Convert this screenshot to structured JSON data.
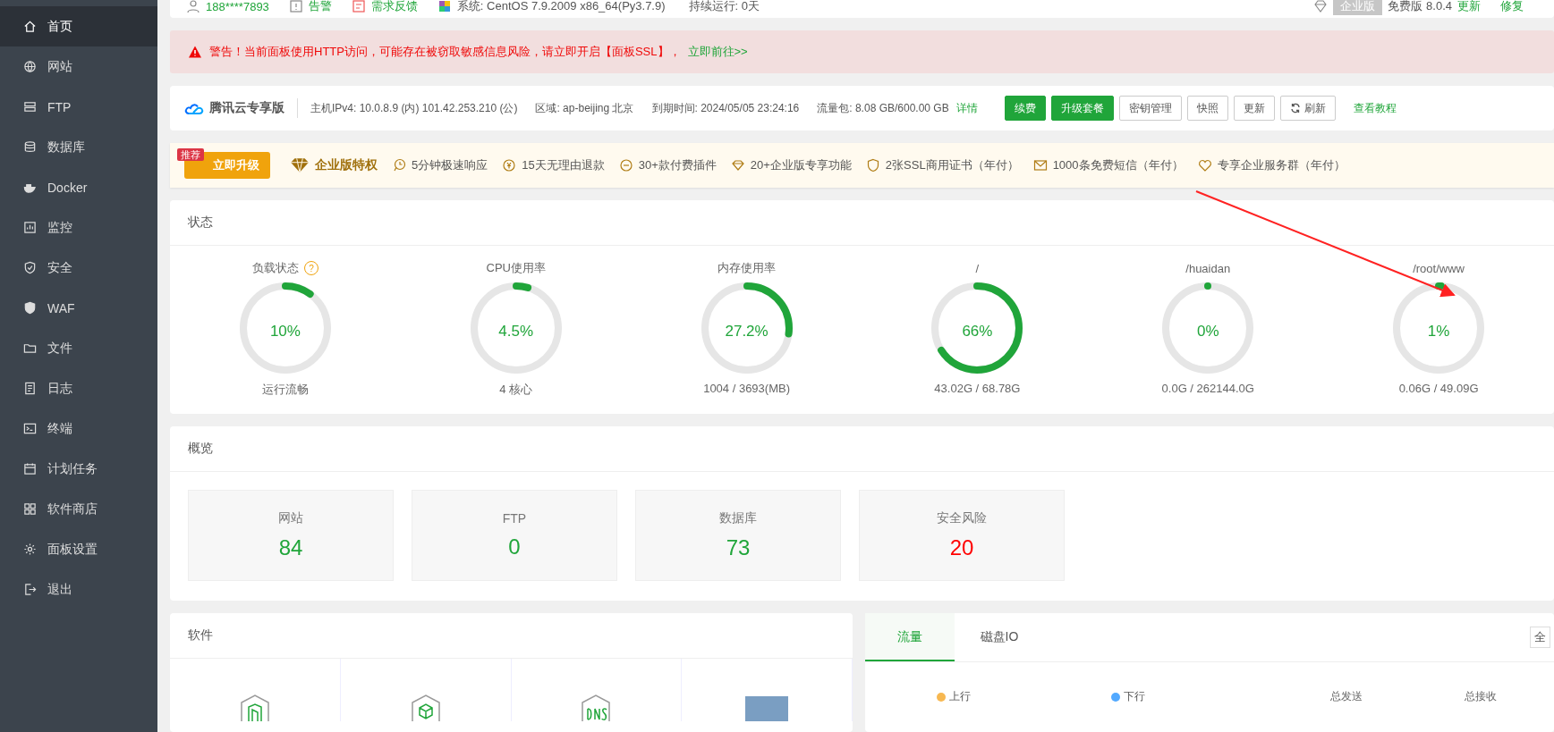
{
  "sidebar": {
    "items": [
      {
        "label": "首页",
        "selected": true
      },
      {
        "label": "网站",
        "selected": false
      },
      {
        "label": "FTP",
        "selected": false
      },
      {
        "label": "数据库",
        "selected": false
      },
      {
        "label": "Docker",
        "selected": false
      },
      {
        "label": "监控",
        "selected": false
      },
      {
        "label": "安全",
        "selected": false
      },
      {
        "label": "WAF",
        "selected": false
      },
      {
        "label": "文件",
        "selected": false
      },
      {
        "label": "日志",
        "selected": false
      },
      {
        "label": "终端",
        "selected": false
      },
      {
        "label": "计划任务",
        "selected": false
      },
      {
        "label": "软件商店",
        "selected": false
      },
      {
        "label": "面板设置",
        "selected": false
      },
      {
        "label": "退出",
        "selected": false
      }
    ]
  },
  "top_bar": {
    "user": "188****7893",
    "alerts": "告警",
    "feedback": "需求反馈",
    "system": "系统:  CentOS 7.9.2009 x86_64(Py3.7.9)",
    "uptime": "持续运行: 0天",
    "edition_badge": "企业版",
    "version": "免费版 8.0.4",
    "links": [
      "更新",
      "修复"
    ]
  },
  "warning": {
    "text": "警告！当前面板使用HTTP访问，可能存在被窃取敏感信息风险，请立即开启【面板SSL】，",
    "link": "立即前往>>"
  },
  "server_info": {
    "brand": "腾讯云专享版",
    "fields": [
      "主机IPv4:  10.0.8.9 (内)  101.42.253.210 (公)",
      "区域:  ap-beijing 北京",
      "到期时间:  2024/05/05 23:24:16",
      "流量包:  8.08 GB/600.00 GB"
    ],
    "detail_link": "详情",
    "buttons": [
      {
        "label": "续费",
        "kind": "primary"
      },
      {
        "label": "升级套餐",
        "kind": "primary"
      },
      {
        "label": "密钥管理",
        "kind": "default"
      },
      {
        "label": "快照",
        "kind": "default"
      },
      {
        "label": "更新",
        "kind": "default"
      },
      {
        "label": "刷新",
        "kind": "refresh"
      }
    ],
    "tutorial_link": "查看教程"
  },
  "enterprise_bar": {
    "ribbon": "推荐",
    "upgrade_button": "立即升级",
    "title": "企业版特权",
    "features": [
      "5分钟极速响应",
      "15天无理由退款",
      "30+款付费插件",
      "20+企业版专享功能",
      "2张SSL商用证书（年付）",
      "1000条免费短信（年付）",
      "专享企业服务群（年付）"
    ]
  },
  "status": {
    "title": "状态",
    "gauges": [
      {
        "label": "负载状态",
        "help": "?",
        "level": 0.1,
        "value": "10%",
        "detail": "运行流畅"
      },
      {
        "label": "CPU使用率",
        "level": 0.045,
        "value": "4.5%",
        "detail": "4 核心"
      },
      {
        "label": "内存使用率",
        "level": 0.272,
        "value": "27.2%",
        "detail": "1004 / 3693(MB)"
      },
      {
        "label": "/",
        "level": 0.66,
        "value": "66%",
        "detail": "43.02G / 68.78G"
      },
      {
        "label": "/huaidan",
        "level": 0,
        "value": "0%",
        "detail": "0.0G / 262144.0G"
      },
      {
        "label": "/root/www",
        "level": 0.01,
        "value": "1%",
        "detail": "0.06G / 49.09G"
      }
    ]
  },
  "overview": {
    "title": "概览",
    "tiles": [
      {
        "label": "网站",
        "value": "84",
        "color": "#20a53a"
      },
      {
        "label": "FTP",
        "value": "0",
        "color": "#20a53a"
      },
      {
        "label": "数据库",
        "value": "73",
        "color": "#20a53a"
      },
      {
        "label": "安全风险",
        "value": "20",
        "color": "#ff0000"
      }
    ]
  },
  "software": {
    "title": "软件"
  },
  "traffic": {
    "tabs": [
      {
        "label": "流量",
        "selected": true
      },
      {
        "label": "磁盘IO",
        "selected": false
      }
    ],
    "select": "全",
    "legend": [
      {
        "label": "上行",
        "color": "#f7b851"
      },
      {
        "label": "下行",
        "color": "#52a9ff"
      }
    ],
    "totals": [
      "总发送",
      "总接收"
    ]
  }
}
